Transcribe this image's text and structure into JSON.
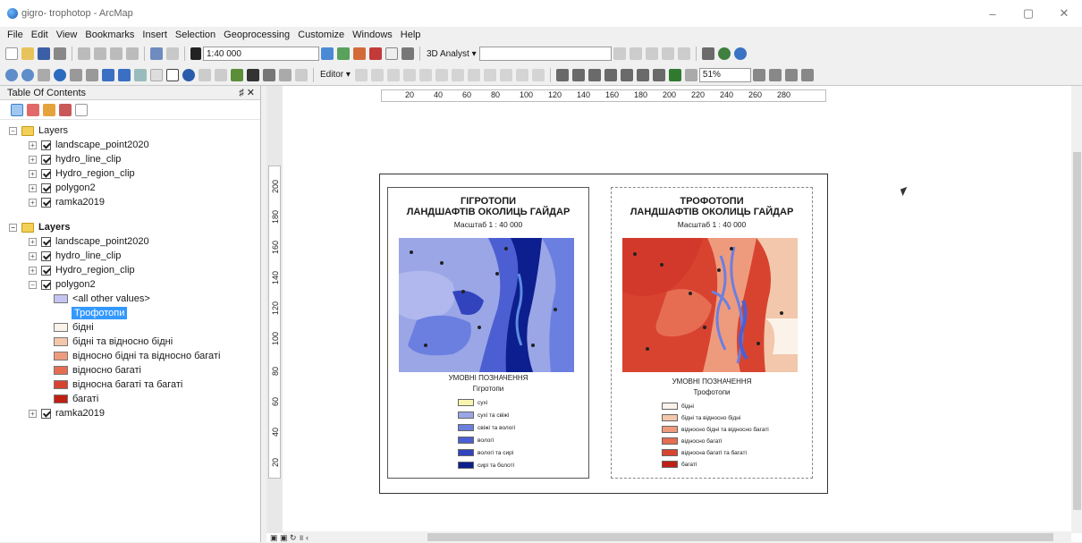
{
  "window": {
    "title": "gigro- trophotop - ArcMap",
    "btn_min": "–",
    "btn_max": "▢",
    "btn_close": "✕"
  },
  "menu": [
    "File",
    "Edit",
    "View",
    "Bookmarks",
    "Insert",
    "Selection",
    "Geoprocessing",
    "Customize",
    "Windows",
    "Help"
  ],
  "toolbar": {
    "scale": "1:40 000",
    "analyst": "3D Analyst ▾",
    "editor": "Editor ▾",
    "zoom": "51%"
  },
  "toc": {
    "title": "Table Of Contents",
    "pin": "♯ ✕",
    "group1": {
      "label": "Layers",
      "layers": [
        "landscape_point2020",
        "hydro_line_clip",
        "Hydro_region_clip",
        "polygon2",
        "ramka2019"
      ]
    },
    "group2": {
      "label": "Layers",
      "layers": [
        "landscape_point2020",
        "hydro_line_clip",
        "Hydro_region_clip",
        "polygon2"
      ],
      "polygon2_items": [
        "<all other values>",
        "Трофотопи",
        "бідні",
        "бідні та відносно бідні",
        "відносно бідні та відносно багаті",
        "відносно багаті",
        "відносна багаті та багаті",
        "багаті"
      ],
      "last_layer": "ramka2019"
    },
    "swatch_colors": [
      "#c4c4f2",
      "#ffffff",
      "#f8e7dd",
      "#f6c4a8",
      "#f29578",
      "#e36a50",
      "#d3392a",
      "#b81d12"
    ]
  },
  "ruler": {
    "h": [
      "20",
      "40",
      "60",
      "80",
      "100",
      "120",
      "140",
      "160",
      "180",
      "200",
      "220",
      "240",
      "260",
      "280"
    ],
    "v": [
      "200",
      "180",
      "160",
      "140",
      "120",
      "100",
      "80",
      "60",
      "40",
      "20"
    ]
  },
  "left_map": {
    "title1": "ГІГРОТОПИ",
    "title2": "ЛАНДШАФТІВ ОКОЛИЦЬ ГАЙДАР",
    "scale": "Масштаб 1 : 40 000",
    "legend_title": "УМОВНІ ПОЗНАЧЕННЯ",
    "legend_sub": "Гігротопи",
    "legend": [
      {
        "label": "сухі",
        "color": "#fbf4b0"
      },
      {
        "label": "сухі та свіжі",
        "color": "#9aa6e6"
      },
      {
        "label": "свіжі та вологі",
        "color": "#6b7fe0"
      },
      {
        "label": "вологі",
        "color": "#4c5fd2"
      },
      {
        "label": "вологі та сирі",
        "color": "#3243be"
      },
      {
        "label": "сирі та болоті",
        "color": "#0d1e8f"
      }
    ]
  },
  "right_map": {
    "title1": "ТРОФОТОПИ",
    "title2": "ЛАНДШАФТІВ ОКОЛИЦЬ ГАЙДАР",
    "scale": "Масштаб 1 : 40 000",
    "legend_title": "УМОВНІ ПОЗНАЧЕННЯ",
    "legend_sub": "Трофотопи",
    "legend": [
      {
        "label": "бідні",
        "color": "#fbf3ea"
      },
      {
        "label": "бідні та відносно бідні",
        "color": "#f3c7ab"
      },
      {
        "label": "відносно бідні та відносно багаті",
        "color": "#ee9b7d"
      },
      {
        "label": "відносно багаті",
        "color": "#e66d52"
      },
      {
        "label": "відносна багаті та багаті",
        "color": "#d84330"
      },
      {
        "label": "багаті",
        "color": "#c01f14"
      }
    ]
  },
  "status": {
    "nav": "▣ ▣ ↻ ॥ ‹"
  }
}
